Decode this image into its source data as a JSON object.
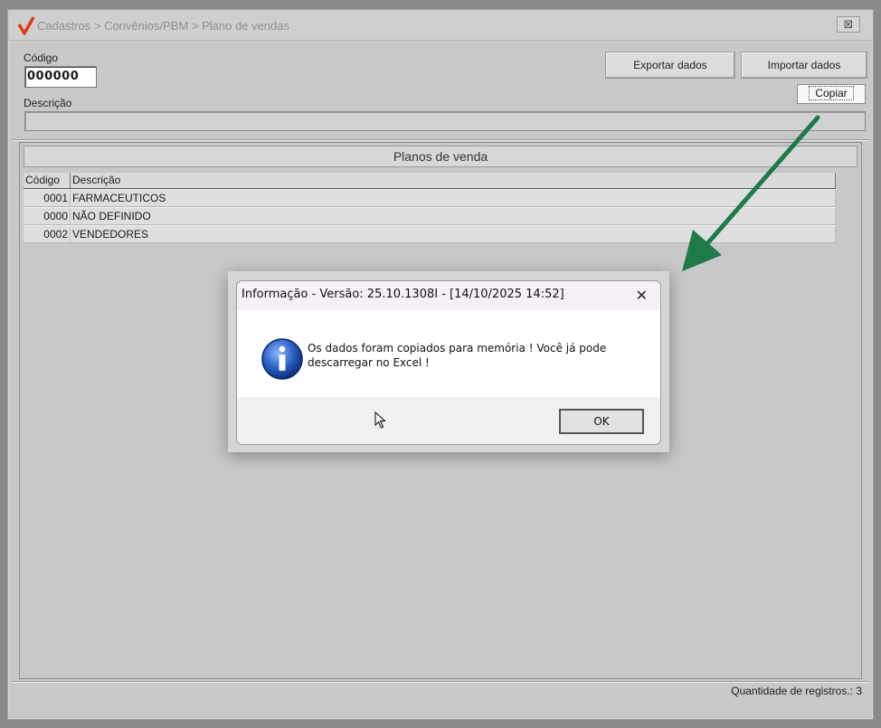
{
  "window": {
    "title": "Cadastros > Convênios/PBM > Plano de vendas",
    "close_glyph": "⊠"
  },
  "form": {
    "codigo_label": "Código",
    "codigo_value": "000000",
    "descricao_label": "Descrição",
    "descricao_value": ""
  },
  "toolbar": {
    "exportar_label": "Exportar dados",
    "importar_label": "Importar dados",
    "copiar_label": "Copiar"
  },
  "panel": {
    "title": "Planos de venda",
    "columns": [
      "Código",
      "Descrição"
    ],
    "rows": [
      {
        "codigo": "0001",
        "descricao": "FARMACEUTICOS"
      },
      {
        "codigo": "0000",
        "descricao": "NÃO DEFINIDO"
      },
      {
        "codigo": "0002",
        "descricao": "VENDEDORES"
      }
    ]
  },
  "status": {
    "registros_text": "Quantidade de registros.: 3"
  },
  "dialog": {
    "title": "Informação - Versão: 25.10.1308I - [14/10/2025 14:52]",
    "close_glyph": "✕",
    "message": "Os dados foram copiados para memória ! Você já pode descarregar no Excel !",
    "ok_label": "OK",
    "icon": "info-icon"
  },
  "colors": {
    "arrow": "#1f7a4a",
    "brand_check": "#e03a1e",
    "info_blue": "#1d4fae"
  }
}
